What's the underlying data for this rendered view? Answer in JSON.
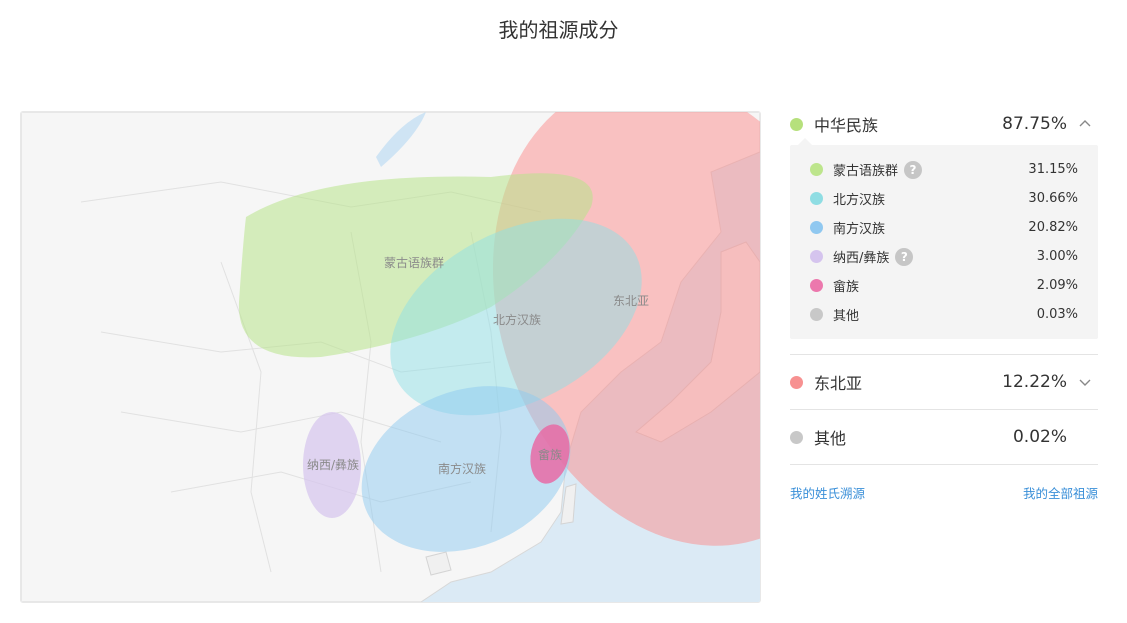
{
  "page": {
    "title": "我的祖源成分"
  },
  "map": {
    "regions": [
      {
        "label": "蒙古语族群",
        "color": "#b8e48a"
      },
      {
        "label": "北方汉族",
        "color": "#8fe0e6"
      },
      {
        "label": "东北亚",
        "color": "#fb8b8b"
      },
      {
        "label": "南方汉族",
        "color": "#8ec9f0"
      },
      {
        "label": "纳西/彝族",
        "color": "#d6c5ee"
      },
      {
        "label": "畲族",
        "color": "#e86aa5"
      }
    ]
  },
  "summary": {
    "groups": [
      {
        "name": "中华民族",
        "pct": "87.75%",
        "color": "#b6e07c",
        "expanded": true,
        "subgroups": [
          {
            "name": "蒙古语族群",
            "pct": "31.15%",
            "color": "#bde58c",
            "help": "?"
          },
          {
            "name": "北方汉族",
            "pct": "30.66%",
            "color": "#8fdde3"
          },
          {
            "name": "南方汉族",
            "pct": "20.82%",
            "color": "#90c8f0"
          },
          {
            "name": "纳西/彝族",
            "pct": "3.00%",
            "color": "#d5c4ee",
            "help": "?"
          },
          {
            "name": "畲族",
            "pct": "2.09%",
            "color": "#ec78ad"
          },
          {
            "name": "其他",
            "pct": "0.03%",
            "color": "#c8c8c8"
          }
        ]
      },
      {
        "name": "东北亚",
        "pct": "12.22%",
        "color": "#f79191",
        "expanded": false
      },
      {
        "name": "其他",
        "pct": "0.02%",
        "color": "#c8c8c8"
      }
    ],
    "links": {
      "surname": "我的姓氏溯源",
      "all": "我的全部祖源"
    }
  }
}
